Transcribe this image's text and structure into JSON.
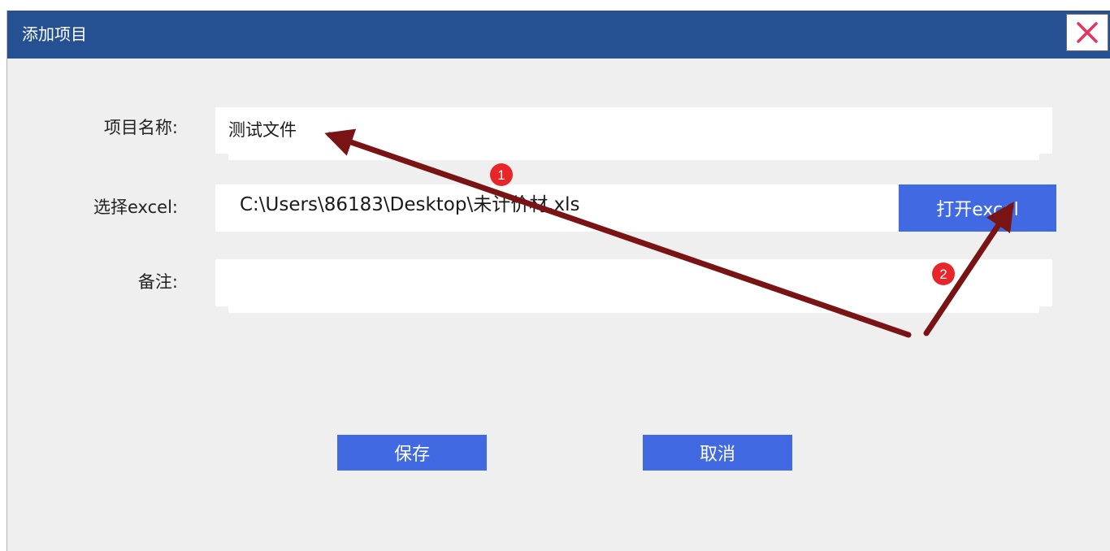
{
  "dialog": {
    "title": "添加项目",
    "close_icon": "close-icon",
    "accent_color": "#255193"
  },
  "form": {
    "project_name": {
      "label": "项目名称:",
      "value": "测试文件"
    },
    "excel": {
      "label": "选择excel:",
      "value": "C:\\Users\\86183\\Desktop\\未计价材.xls",
      "open_button": "打开excel"
    },
    "note": {
      "label": "备注:",
      "value": ""
    }
  },
  "actions": {
    "save": "保存",
    "cancel": "取消"
  },
  "annotations": {
    "marker_1": "1",
    "marker_2": "2",
    "arrow_color": "#7a1414",
    "badge_color": "#e8262a"
  }
}
